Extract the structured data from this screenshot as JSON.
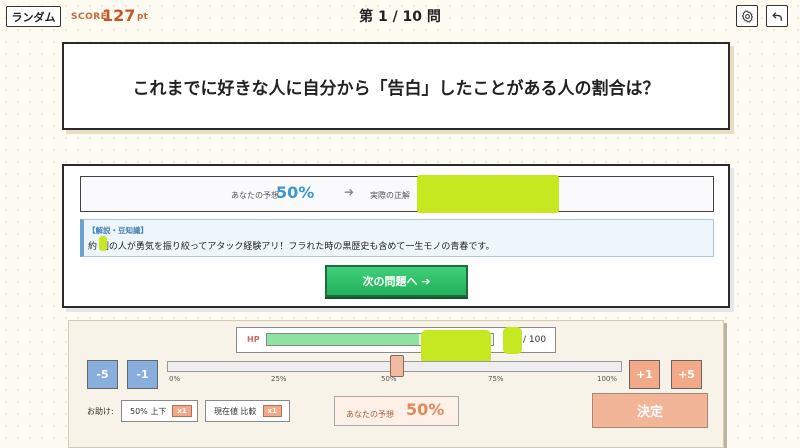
{
  "header": {
    "mode_label": "ランダム",
    "score_label": "SCORE",
    "score_value": "127",
    "score_unit": "pt",
    "progress": "第 1 / 10 問"
  },
  "question": {
    "text": "これまでに好きな人に自分から「告白」したことがある人の割合は？"
  },
  "result": {
    "guess_label": "あなたの予想",
    "guess_value": "50%",
    "arrow": "➔",
    "actual_label": "実際の正解",
    "explain_title": "【解説・豆知識】",
    "explain_text": "約 割の人が勇気を振り絞ってアタック経験アリ！フラれた時の黒歴史も含めて一生モノの青春です。",
    "next_label": "次の問題へ ➔"
  },
  "controls": {
    "hp_label": "HP",
    "hp_max": "/ 100",
    "minus5": "-5",
    "minus1": "-1",
    "plus1": "+1",
    "plus5": "+5",
    "slider_value": 50,
    "ticks": [
      "0%",
      "25%",
      "50%",
      "75%",
      "100%"
    ],
    "help_label": "お助け:",
    "help1_label": "50% 上下",
    "help1_badge": "x1",
    "help2_label": "現在値 比較",
    "help2_badge": "x1",
    "your_guess_label": "あなたの予想",
    "your_guess_value": "50%",
    "submit_label": "決定"
  },
  "colors": {
    "accent_blue": "#3e96d6",
    "accent_orange": "#e0895c",
    "next_green": "#22b15a",
    "redaction": "#c6e820"
  }
}
